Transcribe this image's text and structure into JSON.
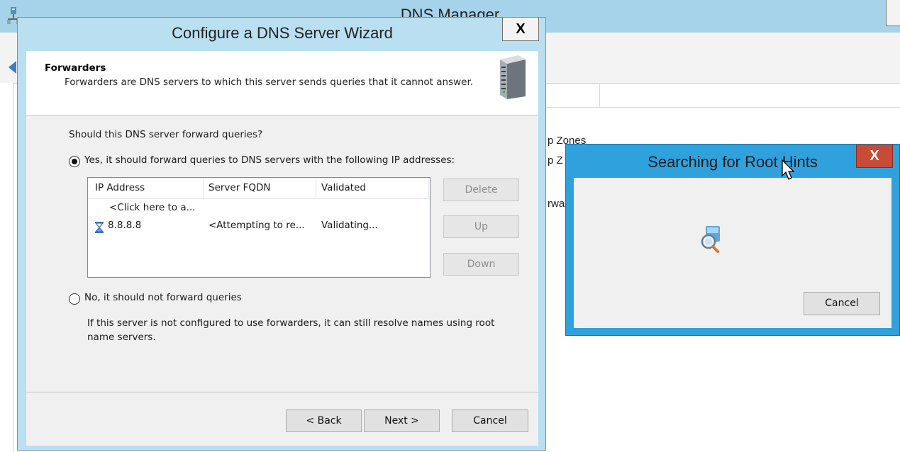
{
  "background_window": {
    "title": "DNS Manager",
    "tree_items": [
      "p Zones",
      "p Z",
      "rwa"
    ]
  },
  "wizard": {
    "title": "Configure a DNS Server Wizard",
    "close_label": "X",
    "header": {
      "title": "Forwarders",
      "description": "Forwarders are DNS servers to which this server sends queries that it cannot answer."
    },
    "question": "Should this DNS server forward queries?",
    "option_yes": "Yes, it should forward queries to DNS servers with the following IP addresses:",
    "option_no": "No, it should not forward queries",
    "selected_option": "yes",
    "no_description": "If this server is not configured to use forwarders, it can still resolve names using root name servers.",
    "table": {
      "columns": [
        "IP Address",
        "Server FQDN",
        "Validated"
      ],
      "rows": [
        {
          "ip": "<Click here to a...",
          "fqdn": "",
          "validated": ""
        },
        {
          "ip": "8.8.8.8",
          "fqdn": "<Attempting to re...",
          "validated": "Validating...",
          "icon": "hourglass-icon"
        }
      ]
    },
    "side_buttons": {
      "delete": "Delete",
      "up": "Up",
      "down": "Down"
    },
    "footer_buttons": {
      "back": "< Back",
      "next": "Next >",
      "cancel": "Cancel"
    }
  },
  "root_hints_dialog": {
    "title": "Searching for Root Hints",
    "close_label": "X",
    "icon": "search-globe-icon",
    "cancel_label": "Cancel"
  },
  "colors": {
    "dialog_frame": "#b9dff1",
    "active_frame": "#2fa2dd",
    "close_button_active": "#c74b35"
  }
}
